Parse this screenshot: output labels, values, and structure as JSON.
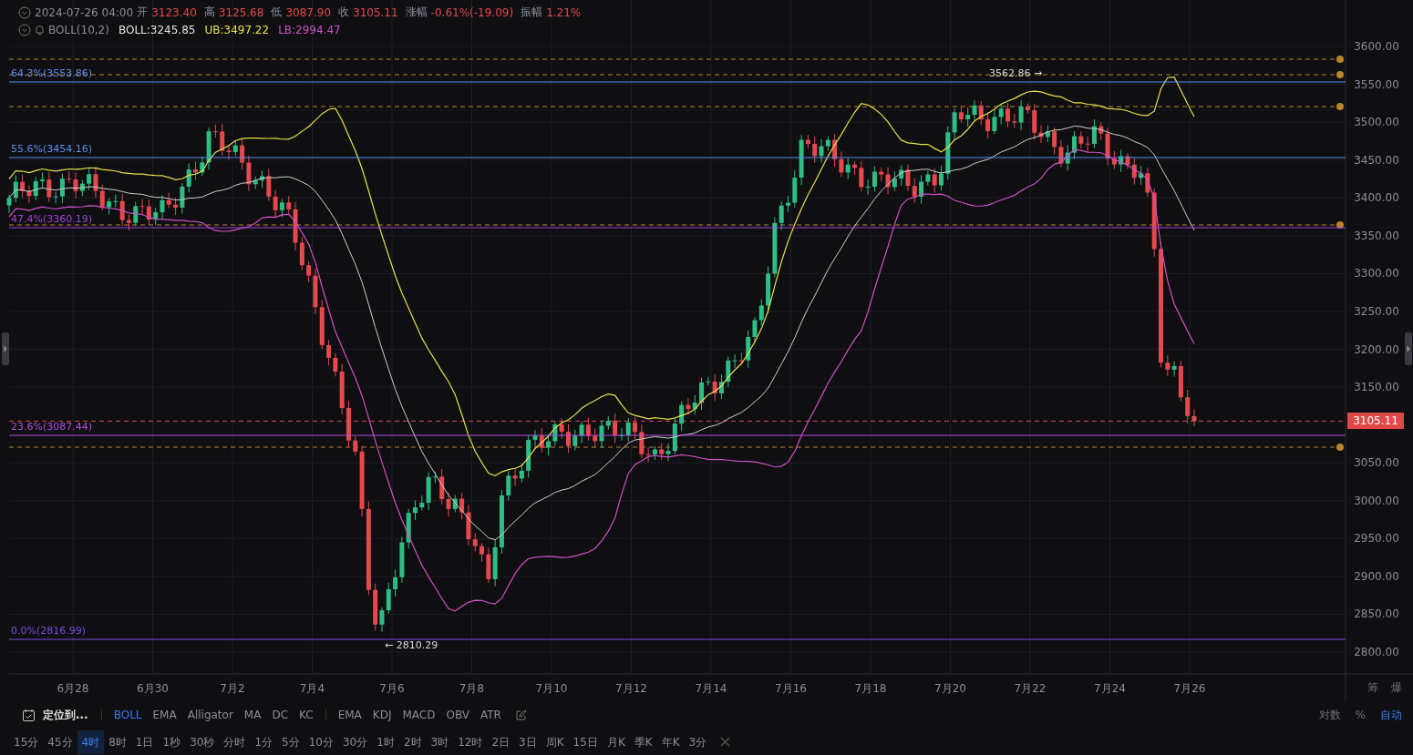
{
  "header": {
    "datetime": "2024-07-26 04:00",
    "ohlc": [
      {
        "label": "开",
        "value": "3123.40"
      },
      {
        "label": "高",
        "value": "3125.68"
      },
      {
        "label": "低",
        "value": "3087.90"
      },
      {
        "label": "收",
        "value": "3105.11"
      },
      {
        "label": "涨幅",
        "value": "-0.61%(-19.09)"
      },
      {
        "label": "振幅",
        "value": "1.21%"
      }
    ],
    "indicator": {
      "name": "BOLL(10,2)",
      "values": [
        {
          "text": "BOLL:3245.85",
          "color": "#e0e0e0"
        },
        {
          "text": "UB:3497.22",
          "color": "#e8e04a"
        },
        {
          "text": "LB:2994.47",
          "color": "#c850c0"
        }
      ]
    }
  },
  "chart": {
    "fib_levels": [
      {
        "label": "64.3%(3553.86)",
        "color": "#5b8def"
      },
      {
        "label": "55.6%(3454.16)",
        "color": "#5b8def"
      },
      {
        "label": "47.4%(3360.19)",
        "color": "#a040e0"
      },
      {
        "label": "23.6%(3087.44)",
        "color": "#b050e0"
      },
      {
        "label": "0.0%(2816.99)",
        "color": "#7a4de0"
      }
    ],
    "annotations": [
      "3562.86 →",
      "← 2810.29"
    ],
    "price_ticks": [
      "3600.00",
      "3550.00",
      "3500.00",
      "3450.00",
      "3400.00",
      "3350.00",
      "3300.00",
      "3250.00",
      "3200.00",
      "3150.00",
      "3050.00",
      "3000.00",
      "2950.00",
      "2900.00",
      "2850.00",
      "2800.00"
    ],
    "current_price": "3105.11",
    "date_labels": [
      "6月28",
      "6月30",
      "7月2",
      "7月4",
      "7月6",
      "7月8",
      "7月10",
      "7月12",
      "7月14",
      "7月16",
      "7月18",
      "7月20",
      "7月22",
      "7月24",
      "7月26"
    ]
  },
  "axis_controls": {
    "top": [
      "筹",
      "爆"
    ],
    "bottom": [
      {
        "label": "对数",
        "selected": false
      },
      {
        "label": "%",
        "selected": false
      },
      {
        "label": "自动",
        "selected": true
      }
    ]
  },
  "toolbar": {
    "locate": "定位到...",
    "main_indicators": [
      {
        "label": "BOLL",
        "selected": true
      },
      {
        "label": "EMA",
        "selected": false
      },
      {
        "label": "Alligator",
        "selected": false
      },
      {
        "label": "MA",
        "selected": false
      },
      {
        "label": "DC",
        "selected": false
      },
      {
        "label": "KC",
        "selected": false
      }
    ],
    "sub_indicators": [
      {
        "label": "EMA",
        "selected": false
      },
      {
        "label": "KDJ",
        "selected": false
      },
      {
        "label": "MACD",
        "selected": false
      },
      {
        "label": "OBV",
        "selected": false
      },
      {
        "label": "ATR",
        "selected": false
      }
    ]
  },
  "intervals": [
    {
      "label": "15分",
      "selected": false
    },
    {
      "label": "45分",
      "selected": false
    },
    {
      "label": "4时",
      "selected": true
    },
    {
      "label": "8时",
      "selected": false
    },
    {
      "label": "1日",
      "selected": false
    },
    {
      "label": "1秒",
      "selected": false
    },
    {
      "label": "30秒",
      "selected": false
    },
    {
      "label": "分时",
      "selected": false
    },
    {
      "label": "1分",
      "selected": false
    },
    {
      "label": "5分",
      "selected": false
    },
    {
      "label": "10分",
      "selected": false
    },
    {
      "label": "30分",
      "selected": false
    },
    {
      "label": "1时",
      "selected": false
    },
    {
      "label": "2时",
      "selected": false
    },
    {
      "label": "3时",
      "selected": false
    },
    {
      "label": "12时",
      "selected": false
    },
    {
      "label": "2日",
      "selected": false
    },
    {
      "label": "3日",
      "selected": false
    },
    {
      "label": "周K",
      "selected": false
    },
    {
      "label": "15日",
      "selected": false
    },
    {
      "label": "月K",
      "selected": false
    },
    {
      "label": "季K",
      "selected": false
    },
    {
      "label": "年K",
      "selected": false
    },
    {
      "label": "3分",
      "selected": false
    }
  ]
}
